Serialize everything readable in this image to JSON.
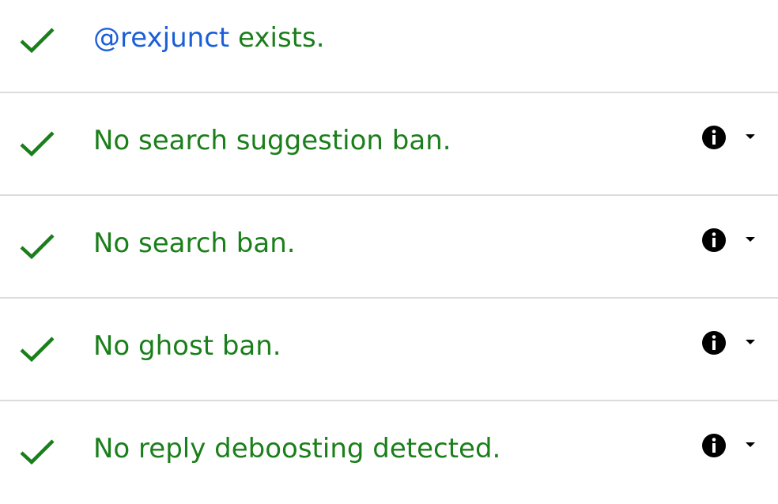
{
  "colors": {
    "success": "#1a7f1a",
    "link": "#1a5fd8",
    "divider": "#dcdcdc",
    "icon": "#000000"
  },
  "rows": [
    {
      "icon": "checkmark-icon",
      "handle": "@rexjunct",
      "text": " exists."
    },
    {
      "icon": "checkmark-icon",
      "text": "No search suggestion ban."
    },
    {
      "icon": "checkmark-icon",
      "text": "No search ban."
    },
    {
      "icon": "checkmark-icon",
      "text": "No ghost ban."
    },
    {
      "icon": "checkmark-icon",
      "text": "No reply deboosting detected."
    }
  ]
}
